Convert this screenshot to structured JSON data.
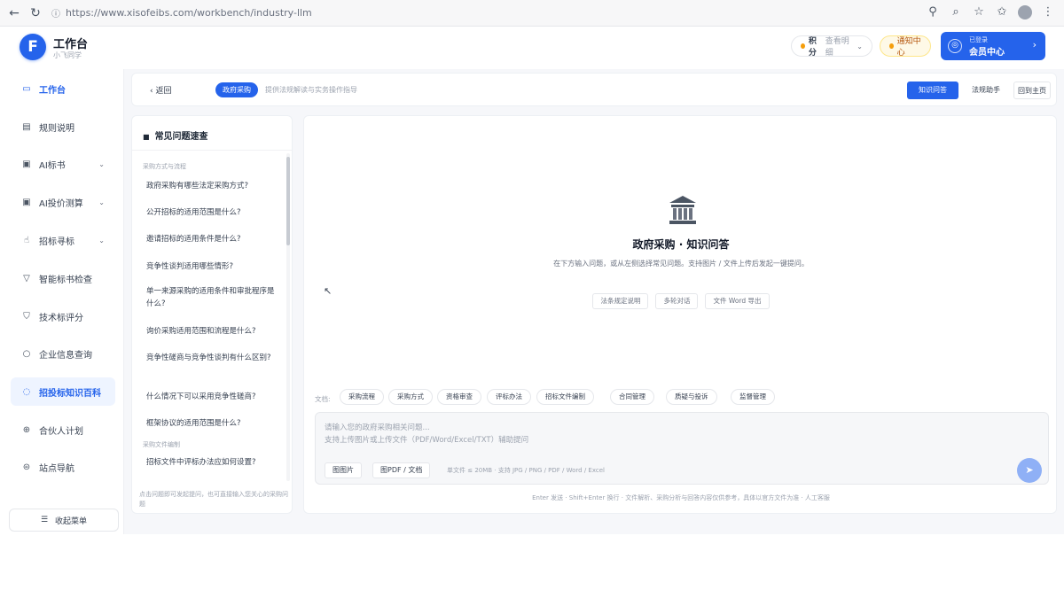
{
  "browser": {
    "url": "https://www.xisofeibs.com/workbench/industry-llm"
  },
  "header": {
    "brand_title": "工作台",
    "brand_sub": "小飞同学",
    "balance_label": "积分",
    "balance_value": "查看明细",
    "notice_label": "通知中心",
    "member_small": "已登录",
    "member_big": "会员中心"
  },
  "sidebar": {
    "items": [
      {
        "label": "工作台",
        "icon": "monitor-icon"
      },
      {
        "label": "规则说明",
        "icon": "doc-icon"
      },
      {
        "label": "AI标书",
        "icon": "ai-doc-icon"
      },
      {
        "label": "AI投价测算",
        "icon": "ai-calc-icon"
      },
      {
        "label": "招标寻标",
        "icon": "search-bid-icon"
      },
      {
        "label": "智能标书检查",
        "icon": "filter-icon"
      },
      {
        "label": "技术标评分",
        "icon": "score-icon"
      },
      {
        "label": "企业信息查询",
        "icon": "search-icon"
      },
      {
        "label": "招投标知识百科",
        "icon": "chat-icon"
      },
      {
        "label": "合伙人计划",
        "icon": "partner-icon"
      },
      {
        "label": "站点导航",
        "icon": "nav-icon"
      }
    ],
    "collapse_label": "收起菜单"
  },
  "topbar": {
    "back_label": "返回",
    "tag_label": "政府采购",
    "tag_desc": "提供法规解读与实务操作指导",
    "btn_primary": "知识问答",
    "btn_plain": "法规助手",
    "btn_outline": "回到主页"
  },
  "faq": {
    "title": "常见问题速查",
    "group1": "采购方式与流程",
    "questions1": [
      "政府采购有哪些法定采购方式?",
      "公开招标的适用范围是什么?",
      "邀请招标的适用条件是什么?",
      "竞争性谈判适用哪些情形?",
      "单一来源采购的适用条件和审批程序是什么?",
      "询价采购适用范围和流程是什么?",
      "竞争性磋商与竞争性谈判有什么区别?",
      "什么情况下可以采用竞争性磋商?",
      "框架协议的适用范围是什么?"
    ],
    "group2": "采购文件编制",
    "questions2": [
      "招标文件中评标办法应如何设置?"
    ],
    "footer": "点击问题即可发起提问，也可直接输入您关心的采购问题"
  },
  "chat": {
    "hero_title": "政府采购 · 知识问答",
    "hero_desc": "在下方输入问题，或从左侧选择常见问题。支持图片 / 文件上传后发起一键提问。",
    "chips": [
      "法条规定说明",
      "多轮对话",
      "文件 Word 导出"
    ],
    "quick_label": "文档:",
    "quick": [
      "采购流程",
      "采购方式",
      "资格审查",
      "评标办法",
      "招标文件编制",
      "合同管理",
      "质疑与投诉",
      "监督管理"
    ],
    "placeholder1": "请输入您的政府采购相关问题...",
    "placeholder2": "支持上传图片或上传文件（PDF/Word/Excel/TXT）辅助提问",
    "upload_image": "图图片",
    "upload_file": "图PDF / 文档",
    "upload_hint": "单文件 ≤ 20MB · 支持 JPG / PNG / PDF / Word / Excel",
    "send_icon": "send-icon",
    "footnote": "Enter 发送 · Shift+Enter 换行 · 文件解析、采购分析与回答内容仅供参考，具体以官方文件为准 · 人工客服"
  },
  "colors": {
    "accent": "#2563eb",
    "active_bg": "#eef4ff",
    "page_bg": "#f6f7fa"
  }
}
